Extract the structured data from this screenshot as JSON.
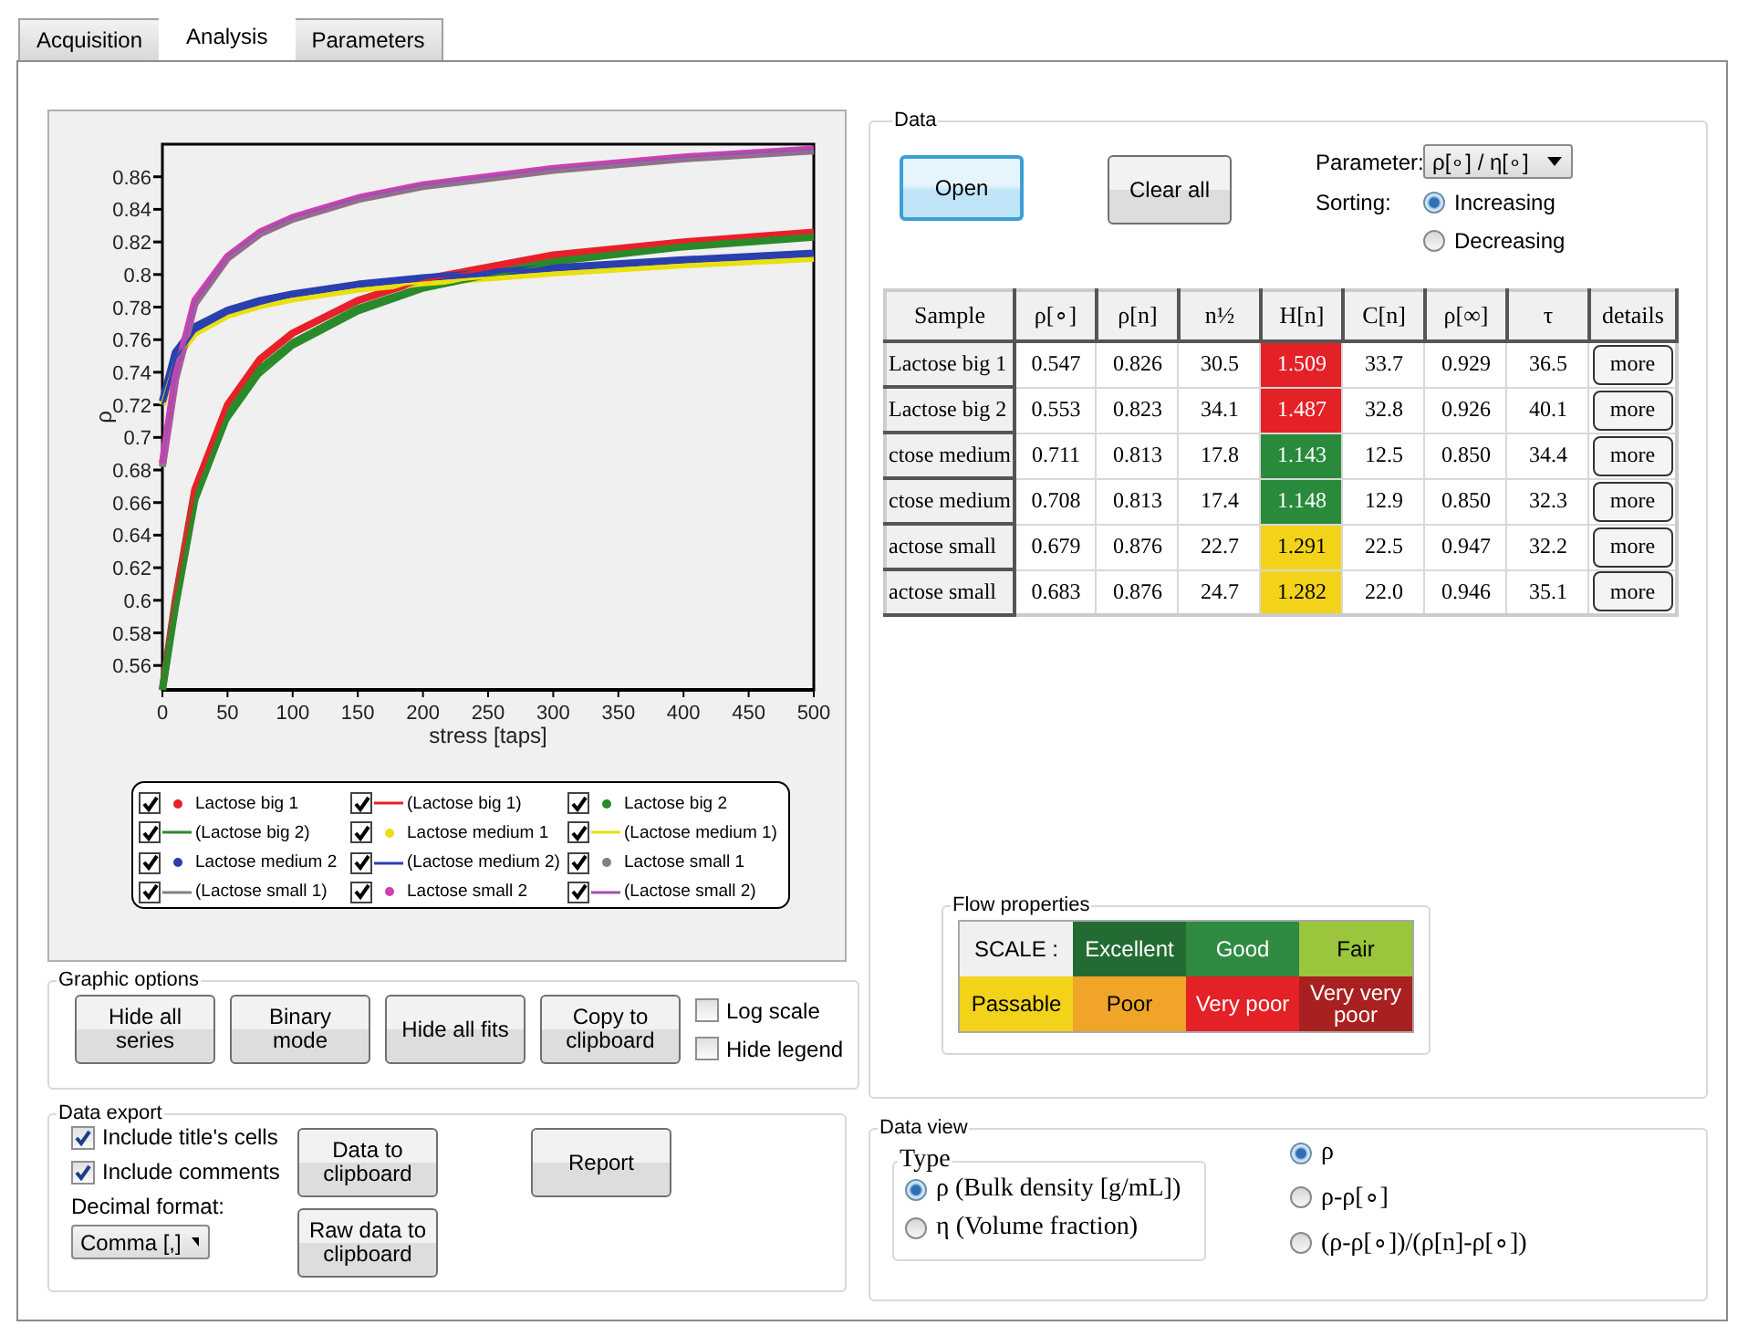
{
  "tabs": [
    {
      "label": "Acquisition",
      "selected": false
    },
    {
      "label": "Analysis",
      "selected": true
    },
    {
      "label": "Parameters",
      "selected": false
    }
  ],
  "chart": {
    "chart_data": {
      "type": "line",
      "xlabel": "stress [taps]",
      "ylabel": "ρ",
      "x": [
        0,
        10,
        25,
        50,
        75,
        100,
        150,
        200,
        300,
        400,
        500
      ],
      "xlim": [
        0,
        500
      ],
      "ylim": [
        0.545,
        0.88
      ],
      "xticks": [
        0,
        50,
        100,
        150,
        200,
        250,
        300,
        350,
        400,
        450,
        500
      ],
      "yticks": [
        0.56,
        0.58,
        {
          "value": 0.6,
          "label": "0.6"
        },
        0.62,
        0.64,
        0.66,
        0.68,
        {
          "value": 0.7,
          "label": "0.7"
        },
        0.72,
        0.74,
        0.76,
        0.78,
        {
          "value": 0.8,
          "label": "0.8"
        },
        0.82,
        0.84,
        0.86
      ],
      "series": [
        {
          "name": "Lactose big 1",
          "color": "#e8202a",
          "values": [
            0.545,
            0.6,
            0.668,
            0.72,
            0.748,
            0.764,
            0.784,
            0.797,
            0.812,
            0.82,
            0.826
          ]
        },
        {
          "name": "(Lactose big 1)",
          "color": "#e8202a",
          "values": [
            0.55,
            0.602,
            0.668,
            0.719,
            0.747,
            0.763,
            0.783,
            0.796,
            0.811,
            0.82,
            0.826
          ]
        },
        {
          "name": "Lactose big 2",
          "color": "#2a8a2a",
          "values": [
            0.545,
            0.596,
            0.662,
            0.714,
            0.742,
            0.758,
            0.779,
            0.792,
            0.808,
            0.817,
            0.823
          ]
        },
        {
          "name": "(Lactose big 2)",
          "color": "#2a8a2a",
          "values": [
            0.55,
            0.598,
            0.66,
            0.71,
            0.738,
            0.755,
            0.776,
            0.79,
            0.807,
            0.816,
            0.822
          ]
        },
        {
          "name": "Lactose medium 1",
          "color": "#e8e010",
          "values": [
            0.72,
            0.748,
            0.764,
            0.775,
            0.781,
            0.785,
            0.791,
            0.795,
            0.801,
            0.806,
            0.81
          ]
        },
        {
          "name": "(Lactose medium 1)",
          "color": "#e8e010",
          "values": [
            0.722,
            0.748,
            0.764,
            0.775,
            0.781,
            0.785,
            0.791,
            0.795,
            0.801,
            0.806,
            0.81
          ]
        },
        {
          "name": "Lactose medium 2",
          "color": "#2a3fb0",
          "values": [
            0.722,
            0.752,
            0.768,
            0.778,
            0.784,
            0.788,
            0.794,
            0.798,
            0.804,
            0.809,
            0.813
          ]
        },
        {
          "name": "(Lactose medium 2)",
          "color": "#2a3fb0",
          "values": [
            0.72,
            0.748,
            0.765,
            0.776,
            0.782,
            0.787,
            0.793,
            0.798,
            0.804,
            0.809,
            0.813
          ]
        },
        {
          "name": "Lactose small 1",
          "color": "#808080",
          "values": [
            0.682,
            0.735,
            0.782,
            0.81,
            0.825,
            0.834,
            0.846,
            0.854,
            0.864,
            0.871,
            0.876
          ]
        },
        {
          "name": "(Lactose small 1)",
          "color": "#808080",
          "values": [
            0.682,
            0.735,
            0.782,
            0.81,
            0.825,
            0.834,
            0.846,
            0.854,
            0.864,
            0.871,
            0.876
          ]
        },
        {
          "name": "Lactose small 2",
          "color": "#d040b0",
          "values": [
            0.684,
            0.737,
            0.784,
            0.811,
            0.826,
            0.835,
            0.847,
            0.855,
            0.865,
            0.872,
            0.877
          ]
        },
        {
          "name": "(Lactose small 2)",
          "color": "#a050b0",
          "values": [
            0.684,
            0.736,
            0.783,
            0.811,
            0.826,
            0.835,
            0.847,
            0.855,
            0.865,
            0.872,
            0.877
          ]
        }
      ]
    },
    "legend": [
      {
        "kind": "dot",
        "checked": true
      },
      {
        "kind": "line",
        "checked": true
      },
      {
        "kind": "dot",
        "checked": true
      },
      {
        "kind": "line",
        "checked": true
      },
      {
        "kind": "dot",
        "checked": true
      },
      {
        "kind": "line",
        "checked": true
      },
      {
        "kind": "dot",
        "checked": true
      },
      {
        "kind": "line",
        "checked": true
      },
      {
        "kind": "dot",
        "checked": true
      },
      {
        "kind": "line",
        "checked": true
      },
      {
        "kind": "dot",
        "checked": true
      },
      {
        "kind": "line",
        "checked": true
      }
    ]
  },
  "graphic_options": {
    "title": "Graphic options",
    "buttons": [
      "Hide all series",
      "Binary mode",
      "Hide all fits",
      "Copy to clipboard"
    ],
    "checkboxes": [
      {
        "label": "Log scale",
        "checked": false
      },
      {
        "label": "Hide legend",
        "checked": false
      }
    ]
  },
  "data_export": {
    "title": "Data export",
    "checkboxes": [
      {
        "label": "Include title's cells",
        "checked": true
      },
      {
        "label": "Include comments",
        "checked": true
      }
    ],
    "decimal_label": "Decimal format:",
    "decimal_value": "Comma [,]",
    "buttons": [
      "Data to clipboard",
      "Raw data to clipboard"
    ],
    "report": "Report"
  },
  "data": {
    "title": "Data",
    "open": "Open",
    "clear": "Clear all",
    "parameter_label": "Parameter:",
    "parameter_value": "ρ[∘] / η[∘]",
    "sorting_label": "Sorting:",
    "sorting": [
      {
        "label": "Increasing",
        "selected": true
      },
      {
        "label": "Decreasing",
        "selected": false
      }
    ],
    "table": {
      "columns": [
        "Sample",
        "ρ[∘]",
        "ρ[n]",
        "n½",
        "H[n]",
        "C[n]",
        "ρ[∞]",
        "τ",
        "details"
      ],
      "rows": [
        {
          "sample": "Lactose big 1",
          "values": [
            "0.547",
            "0.826",
            "30.5",
            "1.509",
            "33.7",
            "0.929",
            "36.5"
          ],
          "color": "#e42127",
          "details": "more"
        },
        {
          "sample": "Lactose big 2",
          "values": [
            "0.553",
            "0.823",
            "34.1",
            "1.487",
            "32.8",
            "0.926",
            "40.1"
          ],
          "color": "#e42127",
          "details": "more"
        },
        {
          "sample": "ctose medium",
          "values": [
            "0.711",
            "0.813",
            "17.8",
            "1.143",
            "12.5",
            "0.850",
            "34.4"
          ],
          "color": "#2a8a3c",
          "details": "more"
        },
        {
          "sample": "ctose medium",
          "values": [
            "0.708",
            "0.813",
            "17.4",
            "1.148",
            "12.9",
            "0.850",
            "32.3"
          ],
          "color": "#2a8a3c",
          "details": "more"
        },
        {
          "sample": "actose small",
          "values": [
            "0.679",
            "0.876",
            "22.7",
            "1.291",
            "22.5",
            "0.947",
            "32.2"
          ],
          "color": "#f2d31a",
          "details": "more"
        },
        {
          "sample": "actose small",
          "values": [
            "0.683",
            "0.876",
            "24.7",
            "1.282",
            "22.0",
            "0.946",
            "35.1"
          ],
          "color": "#f2d31a",
          "details": "more"
        }
      ]
    },
    "flow": {
      "title": "Flow properties",
      "scale_label": "SCALE :",
      "levels": [
        {
          "label": "Excellent",
          "color": "#236b33"
        },
        {
          "label": "Good",
          "color": "#2f8a42"
        },
        {
          "label": "Fair",
          "color": "#9bc53d"
        },
        {
          "label": "Passable",
          "color": "#f2d31a"
        },
        {
          "label": "Poor",
          "color": "#f0a428"
        },
        {
          "label": "Very poor",
          "color": "#e42127"
        },
        {
          "label": "Very very poor",
          "color": "#a8201f"
        }
      ]
    }
  },
  "data_view": {
    "title": "Data view",
    "type_title": "Type",
    "types": [
      {
        "label": "ρ (Bulk density [g/mL])",
        "selected": true
      },
      {
        "label": "η (Volume fraction)",
        "selected": false
      }
    ],
    "views": [
      {
        "label": "ρ",
        "selected": true
      },
      {
        "label": "ρ-ρ[∘]",
        "selected": false
      },
      {
        "label": "(ρ-ρ[∘])/(ρ[n]-ρ[∘])",
        "selected": false
      }
    ]
  }
}
